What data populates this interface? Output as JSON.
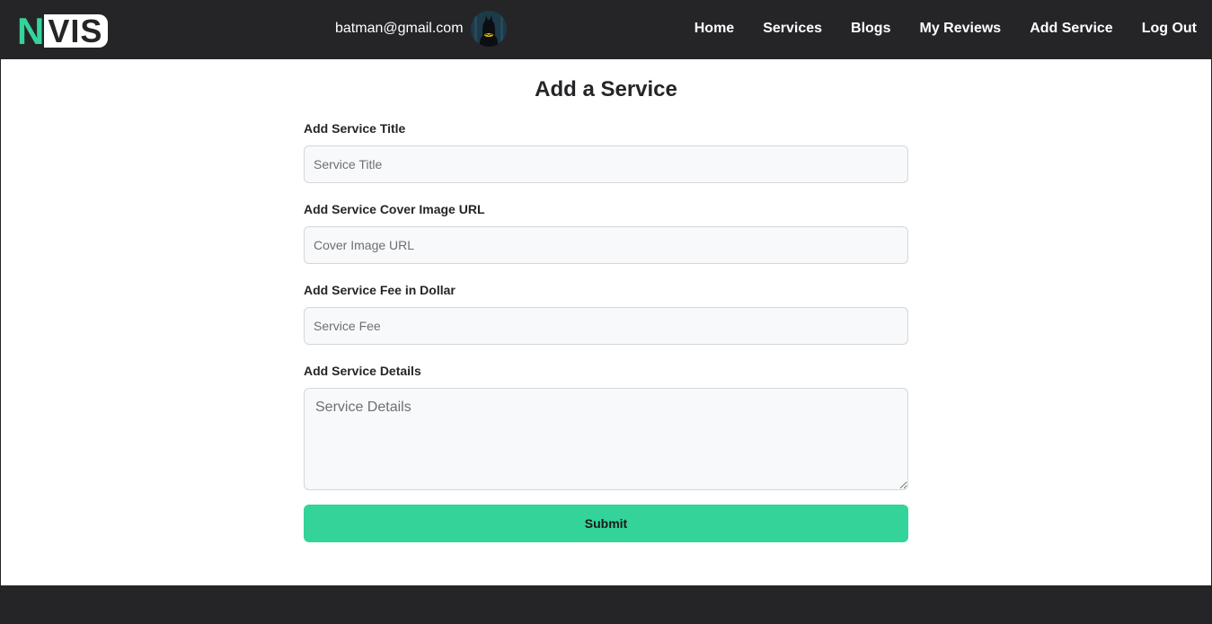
{
  "header": {
    "logo": {
      "letter": "N",
      "boxed_text": "VIS"
    },
    "user_email": "batman@gmail.com",
    "nav": [
      {
        "label": "Home"
      },
      {
        "label": "Services"
      },
      {
        "label": "Blogs"
      },
      {
        "label": "My Reviews"
      },
      {
        "label": "Add Service"
      },
      {
        "label": "Log Out"
      }
    ]
  },
  "form": {
    "title": "Add a Service",
    "fields": [
      {
        "label": "Add Service Title",
        "placeholder": "Service Title"
      },
      {
        "label": "Add Service Cover Image URL",
        "placeholder": "Cover Image URL"
      },
      {
        "label": "Add Service Fee in Dollar",
        "placeholder": "Service Fee"
      },
      {
        "label": "Add Service Details",
        "placeholder": "Service Details"
      }
    ],
    "submit_label": "Submit"
  },
  "colors": {
    "accent": "#34d399",
    "dark": "#252528",
    "input_bg": "#f8f9fa"
  }
}
